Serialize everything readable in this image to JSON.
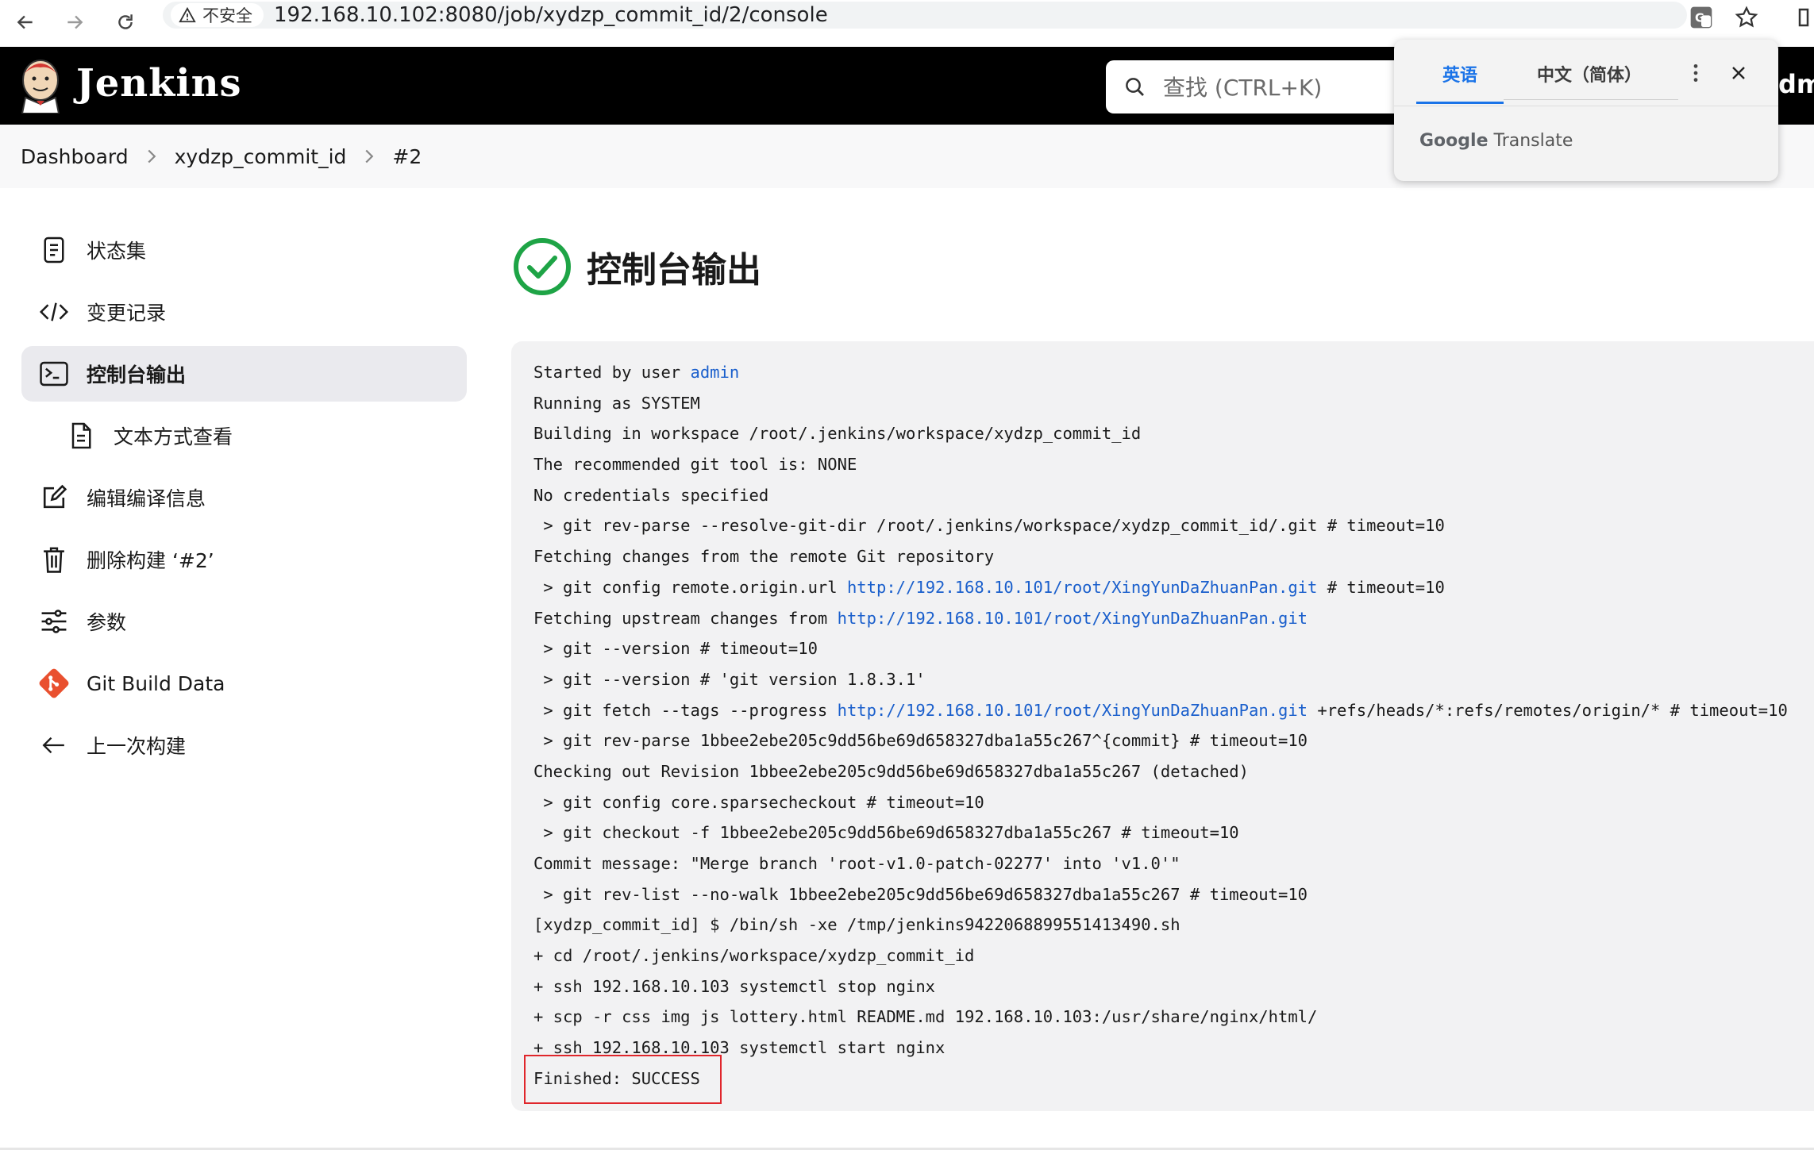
{
  "browser": {
    "security_label": "不安全",
    "url": "192.168.10.102:8080/job/xydzp_commit_id/2/console"
  },
  "header": {
    "brand": "Jenkins",
    "search_placeholder": "查找 (CTRL+K)",
    "user_fragment": "dm"
  },
  "breadcrumb": [
    "Dashboard",
    "xydzp_commit_id",
    "#2"
  ],
  "translate_popup": {
    "tab_source": "英语",
    "tab_target": "中文（简体）",
    "brand_google": "Google",
    "brand_translate": "Translate"
  },
  "sidebar": {
    "items": [
      {
        "label": "状态集",
        "icon": "document-icon"
      },
      {
        "label": "变更记录",
        "icon": "code-icon"
      },
      {
        "label": "控制台输出",
        "icon": "terminal-icon"
      },
      {
        "label": "文本方式查看",
        "icon": "file-text-icon"
      },
      {
        "label": "编辑编译信息",
        "icon": "edit-icon"
      },
      {
        "label": "删除构建 ‘#2’",
        "icon": "trash-icon"
      },
      {
        "label": "参数",
        "icon": "sliders-icon"
      },
      {
        "label": "Git Build Data",
        "icon": "git-icon"
      },
      {
        "label": "上一次构建",
        "icon": "arrow-left-icon"
      }
    ]
  },
  "main": {
    "title": "控制台输出",
    "console": {
      "l1_pre": "Started by user ",
      "l1_link": "admin",
      "l2": "Running as SYSTEM",
      "l3": "Building in workspace /root/.jenkins/workspace/xydzp_commit_id",
      "l4": "The recommended git tool is: NONE",
      "l5": "No credentials specified",
      "l6": " > git rev-parse --resolve-git-dir /root/.jenkins/workspace/xydzp_commit_id/.git # timeout=10",
      "l7": "Fetching changes from the remote Git repository",
      "l8_pre": " > git config remote.origin.url ",
      "l8_link": "http://192.168.10.101/root/XingYunDaZhuanPan.git",
      "l8_post": " # timeout=10",
      "l9_pre": "Fetching upstream changes from ",
      "l9_link": "http://192.168.10.101/root/XingYunDaZhuanPan.git",
      "l10": " > git --version # timeout=10",
      "l11": " > git --version # 'git version 1.8.3.1'",
      "l12_pre": " > git fetch --tags --progress ",
      "l12_link": "http://192.168.10.101/root/XingYunDaZhuanPan.git",
      "l12_post": " +refs/heads/*:refs/remotes/origin/* # timeout=10",
      "l13": " > git rev-parse 1bbee2ebe205c9dd56be69d658327dba1a55c267^{commit} # timeout=10",
      "l14": "Checking out Revision 1bbee2ebe205c9dd56be69d658327dba1a55c267 (detached)",
      "l15": " > git config core.sparsecheckout # timeout=10",
      "l16": " > git checkout -f 1bbee2ebe205c9dd56be69d658327dba1a55c267 # timeout=10",
      "l17": "Commit message: \"Merge branch 'root-v1.0-patch-02277' into 'v1.0'\"",
      "l18": " > git rev-list --no-walk 1bbee2ebe205c9dd56be69d658327dba1a55c267 # timeout=10",
      "l19": "[xydzp_commit_id] $ /bin/sh -xe /tmp/jenkins9422068899551413490.sh",
      "l20": "+ cd /root/.jenkins/workspace/xydzp_commit_id",
      "l21": "+ ssh 192.168.10.103 systemctl stop nginx",
      "l22": "+ scp -r css img js lottery.html README.md 192.168.10.103:/usr/share/nginx/html/",
      "l23": "+ ssh 192.168.10.103 systemctl start nginx",
      "l24": "Finished: SUCCESS"
    }
  },
  "colors": {
    "header_bg": "#000000",
    "success_green": "#1ea446",
    "link_blue": "#1a5fcc",
    "highlight_red": "#e0262b",
    "translate_blue": "#1a73e8"
  }
}
